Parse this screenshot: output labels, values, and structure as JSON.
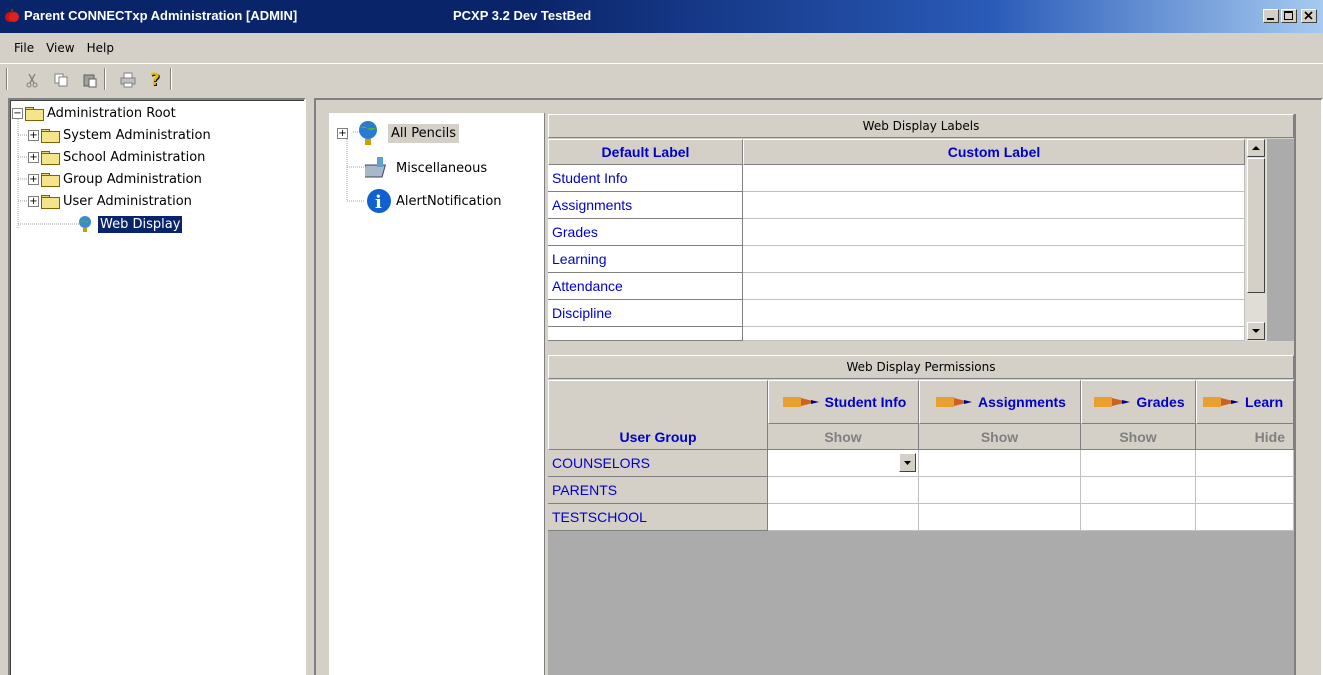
{
  "window": {
    "title": "Parent CONNECTxp Administration [ADMIN]",
    "subtitle": "PCXP 3.2 Dev TestBed"
  },
  "menu": [
    "File",
    "View",
    "Help"
  ],
  "toolbar": {
    "icons": [
      "cut-icon",
      "copy-icon",
      "paste-icon",
      "print-icon",
      "help-icon"
    ]
  },
  "admin_tree": {
    "root": "Administration Root",
    "items": [
      "System Administration",
      "School Administration",
      "Group Administration",
      "User Administration"
    ],
    "selected": "Web Display"
  },
  "pencil_tree": {
    "items": [
      "All Pencils",
      "Miscellaneous",
      "AlertNotification"
    ]
  },
  "labels_grid": {
    "title": "Web Display Labels",
    "columns": [
      "Default Label",
      "Custom Label"
    ],
    "rows": [
      "Student Info",
      "Assignments",
      "Grades",
      "Learning",
      "Attendance",
      "Discipline"
    ]
  },
  "permissions_grid": {
    "title": "Web Display Permissions",
    "group_header": "User Group",
    "columns": [
      {
        "label": "Student Info",
        "value": "Show"
      },
      {
        "label": "Assignments",
        "value": "Show"
      },
      {
        "label": "Grades",
        "value": "Show"
      },
      {
        "label": "Learn",
        "value": "Hide"
      }
    ],
    "groups": [
      "COUNSELORS",
      "PARENTS",
      "TESTSCHOOL"
    ]
  }
}
